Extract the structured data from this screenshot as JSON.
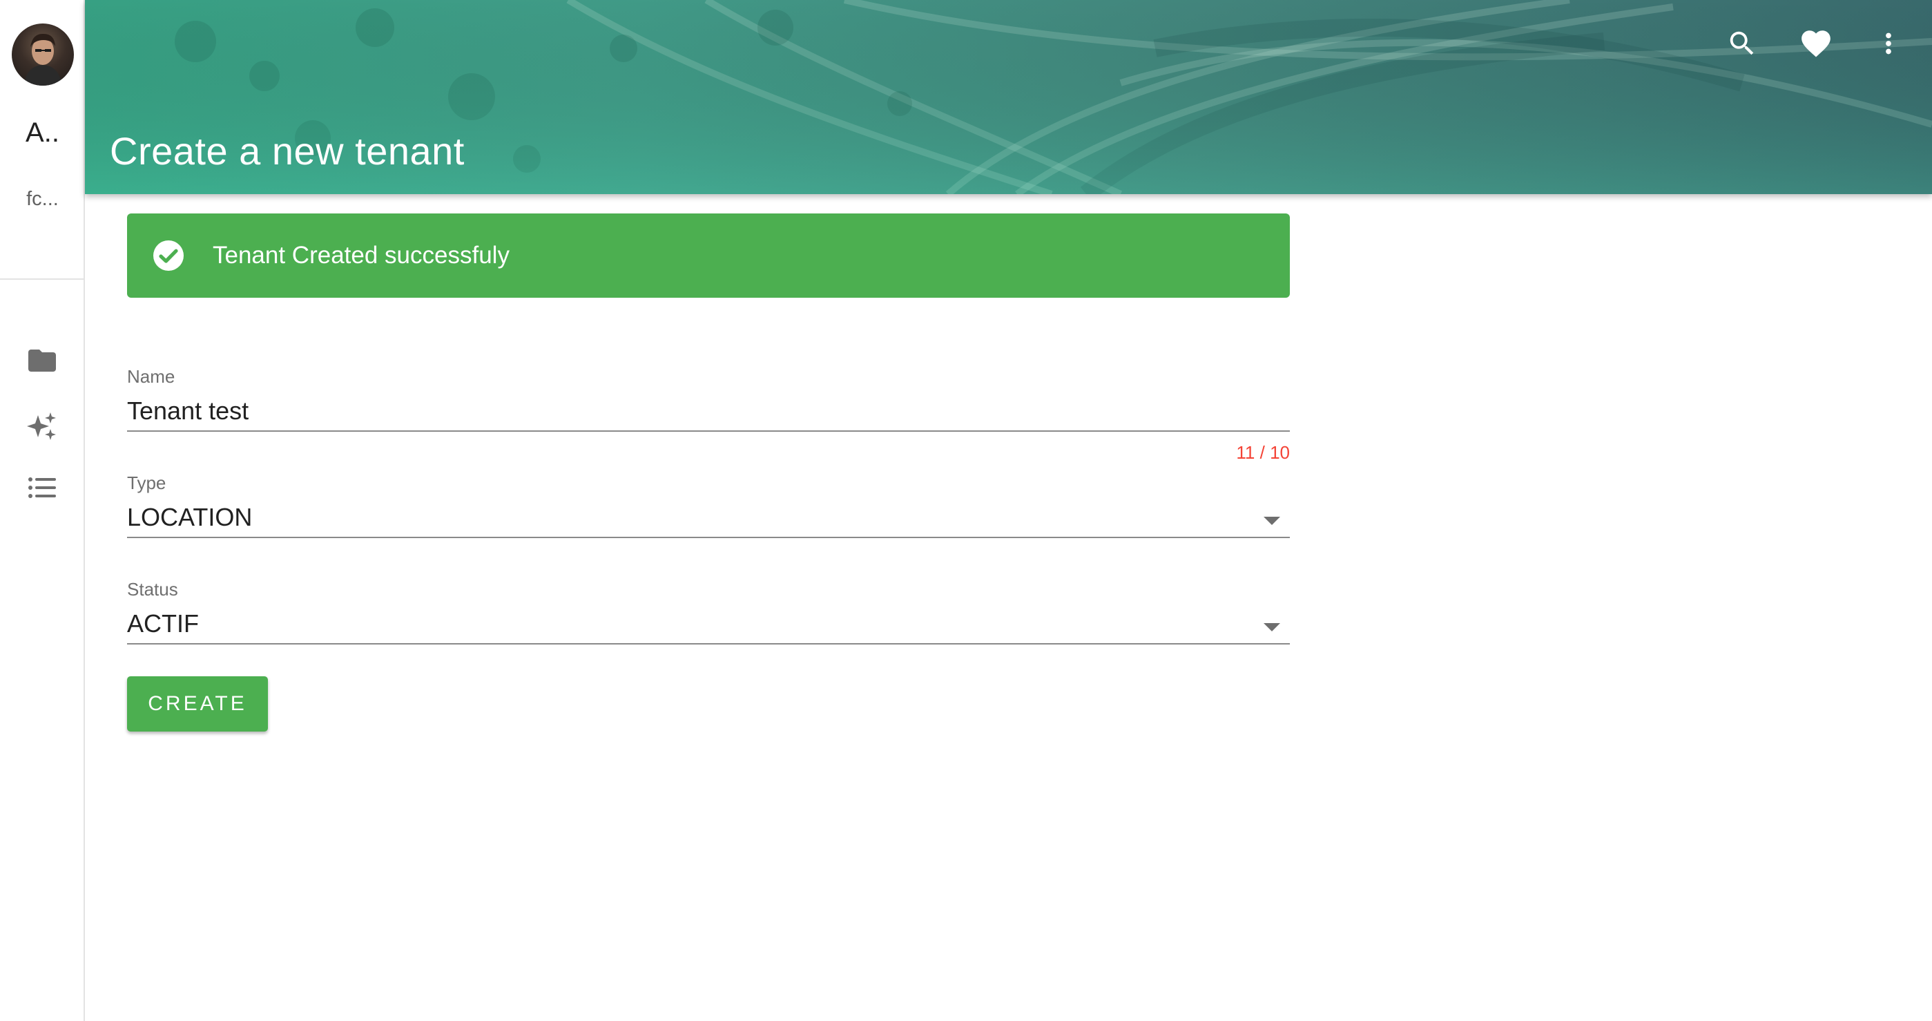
{
  "sidebar": {
    "user_initials": "A..",
    "user_email": "fc...",
    "nav_items": [
      {
        "icon": "folder-icon"
      },
      {
        "icon": "sparkles-icon"
      },
      {
        "icon": "list-icon"
      }
    ]
  },
  "header": {
    "title": "Create a new tenant",
    "actions": [
      "search-icon",
      "heart-icon",
      "more-vert-icon"
    ]
  },
  "alert": {
    "message": "Tenant Created successfuly",
    "color": "#4caf50"
  },
  "form": {
    "name": {
      "label": "Name",
      "value": "Tenant test",
      "counter": "11 / 10"
    },
    "type": {
      "label": "Type",
      "value": "LOCATION"
    },
    "status": {
      "label": "Status",
      "value": "ACTIF"
    },
    "submit_label": "CREATE"
  },
  "colors": {
    "accent": "#4caf50",
    "error": "#f44336",
    "header_teal": "#44a28e"
  }
}
